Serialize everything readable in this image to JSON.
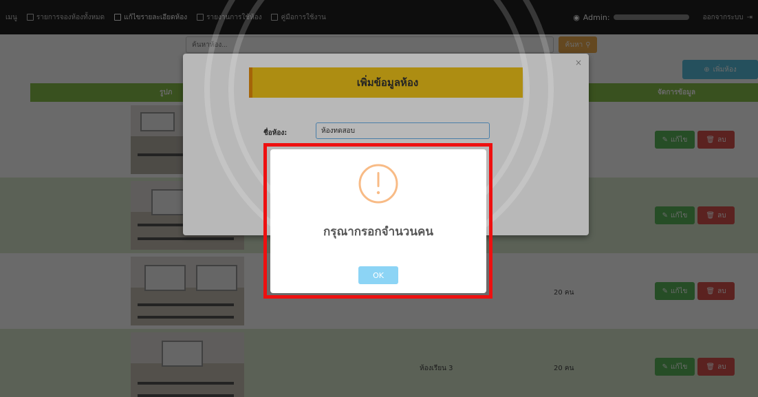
{
  "navbar": {
    "menu_label": "เมนู",
    "items": [
      {
        "label": "รายการจองห้องทั้งหมด"
      },
      {
        "label": "แก้ไขรายละเอียดห้อง"
      },
      {
        "label": "รายงานการใช้ห้อง"
      },
      {
        "label": "คู่มือการใช้งาน"
      }
    ],
    "admin_label": "Admin:",
    "logout_label": "ออกจากระบบ"
  },
  "search": {
    "placeholder": "ค้นหาห้อง...",
    "button_label": "ค้นหา"
  },
  "add_room_button": "เพิ่มห้อง",
  "table": {
    "headers": {
      "image": "รูปภ",
      "manage": "จัดการข้อมูล"
    },
    "edit_label": "แก้ไข",
    "delete_label": "ลบ",
    "rows": [
      {
        "room": "",
        "capacity": ""
      },
      {
        "room": "",
        "capacity": ""
      },
      {
        "room": "",
        "capacity": "20 คน"
      },
      {
        "room": "ห้องเรียน 3",
        "capacity": "20 คน"
      }
    ]
  },
  "add_modal": {
    "close": "×",
    "title": "เพิ่มข้อมูลห้อง",
    "field_label": "ชื่อห้อง:",
    "field_value": "ห้องทดสอบ"
  },
  "alert": {
    "icon": "warning-exclamation-icon",
    "message": "กรุณากรอกจำนวนคน",
    "ok_label": "OK"
  }
}
